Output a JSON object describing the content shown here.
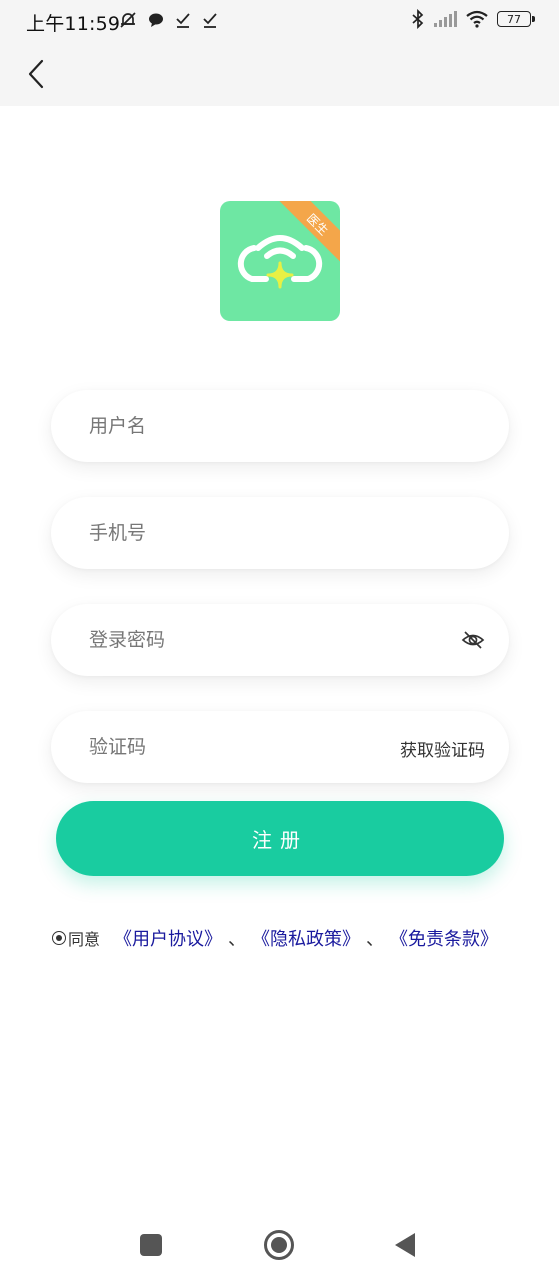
{
  "status_bar": {
    "time": "上午11:59",
    "battery": "77"
  },
  "form": {
    "username_placeholder": "用户名",
    "phone_placeholder": "手机号",
    "password_placeholder": "登录密码",
    "code_placeholder": "验证码",
    "get_code_label": "获取验证码",
    "register_label": "注册"
  },
  "agreement": {
    "prefix": "同意",
    "user_agreement": "《用户协议》",
    "privacy_policy": "《隐私政策》",
    "disclaimer": "《免责条款》",
    "separator": "、"
  },
  "logo": {
    "badge": "医生",
    "color": "#6ee7a3",
    "badge_color": "#f4a64a"
  },
  "colors": {
    "accent": "#19cca0",
    "link": "#1a1a9e"
  },
  "icons": [
    "back-arrow-icon",
    "eye-hidden-icon",
    "nav-square-icon",
    "nav-home-icon",
    "nav-back-icon"
  ]
}
